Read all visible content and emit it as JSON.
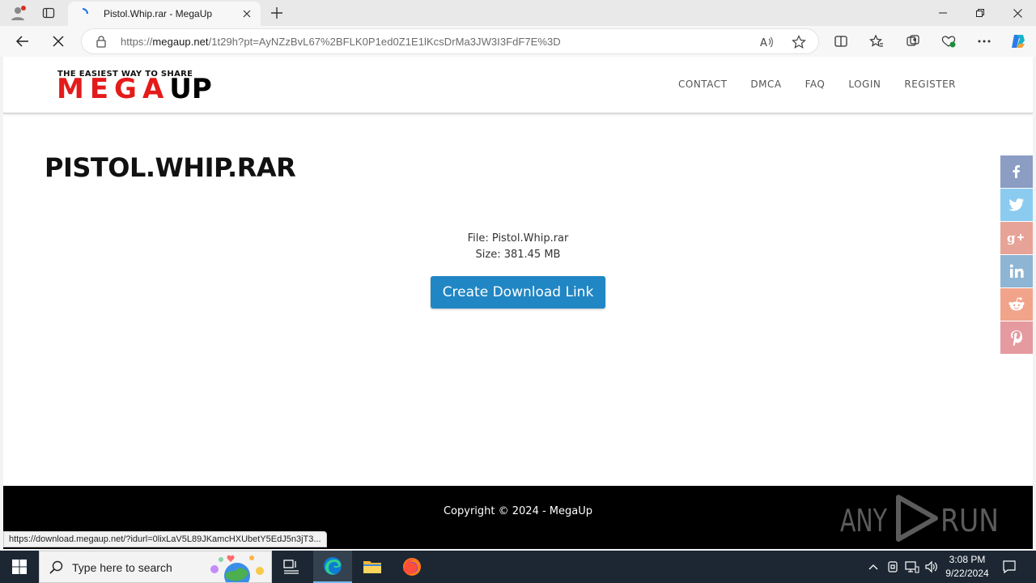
{
  "browser": {
    "tab_title": "Pistol.Whip.rar - MegaUp",
    "url_prefix": "https://",
    "url_host": "megaup.net",
    "url_path": "/1t29h?pt=AyNZzBvL67%2BFLK0P1ed0Z1E1lKcsDrMa3JW3I3FdF7E%3D",
    "status_url": "https://download.megaup.net/?idurl=0lixLaV5L89JKamcHXUbetY5EdJ5n3jT3..."
  },
  "site": {
    "logo_tagline": "THE EASIEST WAY TO SHARE",
    "logo_text_red": "MEGA",
    "logo_text_black": "UP",
    "nav": [
      {
        "label": "CONTACT"
      },
      {
        "label": "DMCA"
      },
      {
        "label": "FAQ"
      },
      {
        "label": "LOGIN"
      },
      {
        "label": "REGISTER"
      }
    ],
    "page_title": "PISTOL.WHIP.RAR",
    "file_line": "File: Pistol.Whip.rar",
    "size_line": "Size: 381.45 MB",
    "download_button": "Create Download Link",
    "share": [
      {
        "icon": "facebook-icon",
        "glyph": "f",
        "color": "#8b9dc3"
      },
      {
        "icon": "twitter-icon",
        "glyph": "t",
        "color": "#8ccbf0"
      },
      {
        "icon": "google-plus-icon",
        "glyph": "g+",
        "color": "#e7a397"
      },
      {
        "icon": "linkedin-icon",
        "glyph": "in",
        "color": "#8fb5d4"
      },
      {
        "icon": "reddit-icon",
        "glyph": "r",
        "color": "#f2a48b"
      },
      {
        "icon": "pinterest-icon",
        "glyph": "P",
        "color": "#e59aa0"
      }
    ],
    "footer_text": "Copyright © 2024 - MegaUp",
    "watermark": "ANY RUN"
  },
  "taskbar": {
    "search_placeholder": "Type here to search",
    "time": "3:08 PM",
    "date": "9/22/2024"
  },
  "colors": {
    "accent_button": "#2186c4",
    "logo_red": "#e41b1b",
    "taskbar": "#1c2733"
  }
}
